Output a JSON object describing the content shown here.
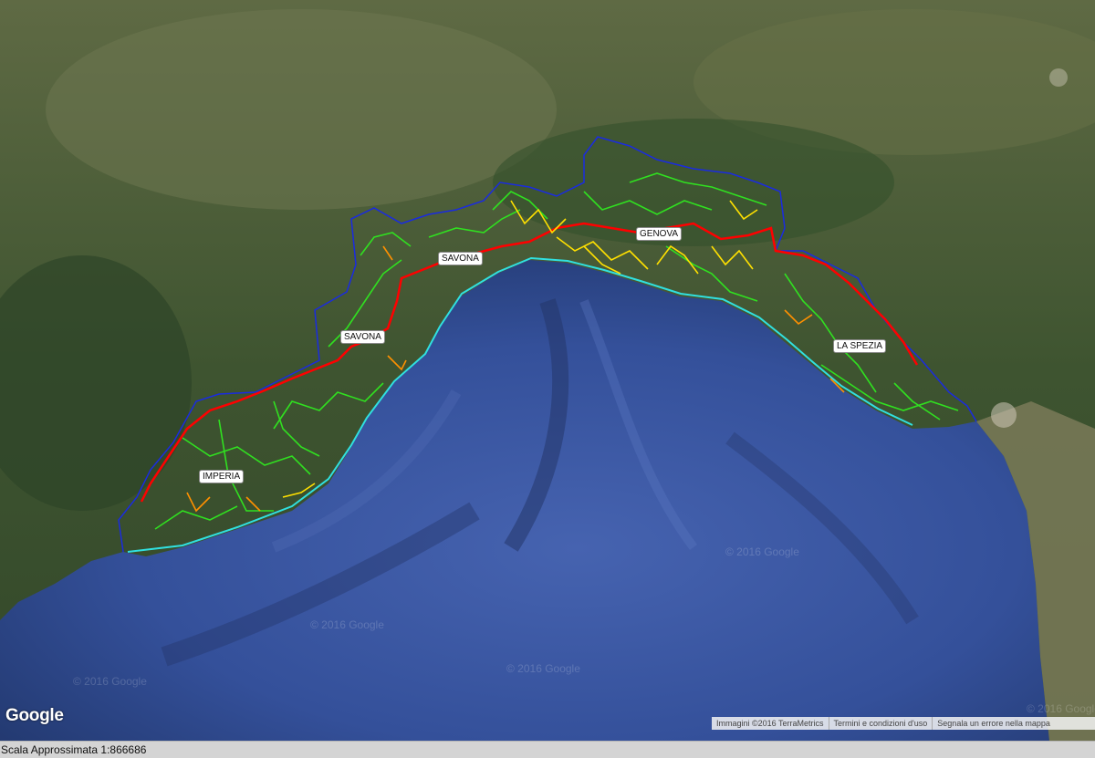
{
  "map": {
    "labels": {
      "imperia": "IMPERIA",
      "savona_coast": "SAVONA",
      "savona_north": "SAVONA",
      "genova": "GENOVA",
      "la_spezia": "LA SPEZIA"
    },
    "watermarks": [
      "© 2016 Google",
      "© 2016 Google",
      "© 2016 Google",
      "© 2016 Google",
      "© 2016 Google"
    ],
    "colors": {
      "sea": "#334f95",
      "land": "#3f5430",
      "boundary": "#1020d0",
      "road_red": "#ff0000",
      "road_yellow": "#ffe000",
      "road_green": "#30e020",
      "road_orange": "#ff9000",
      "road_cyan": "#30e0e0"
    }
  },
  "logo": "Google",
  "attribution": {
    "imagery": "Immagini ©2016 TerraMetrics",
    "terms": "Termini e condizioni d'uso",
    "report": "Segnala un errore nella mappa"
  },
  "status": {
    "scale": "Scala Approssimata 1:866686"
  }
}
